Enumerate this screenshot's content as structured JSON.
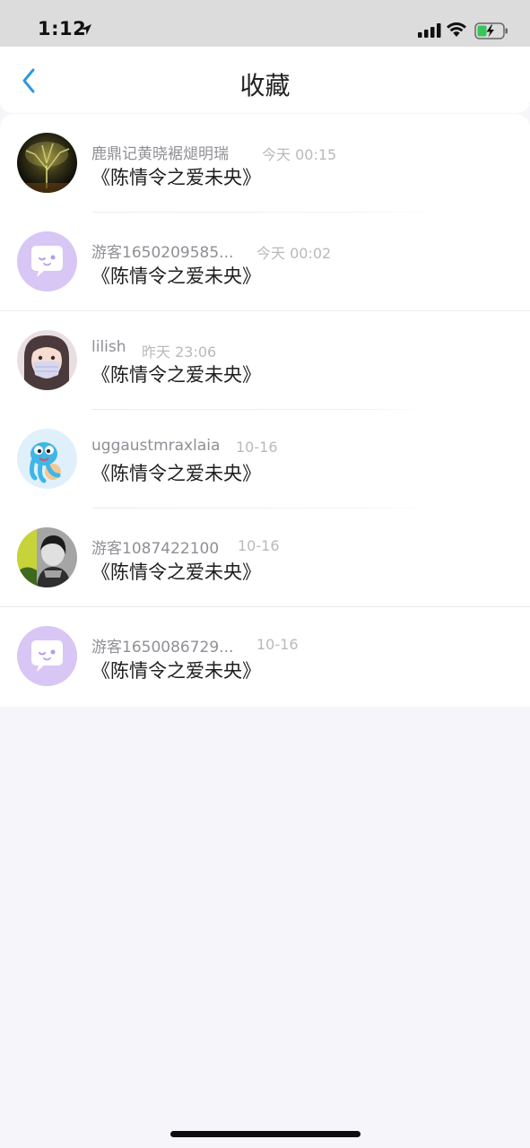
{
  "status_bar": {
    "time": "1:12",
    "icons": [
      "location-arrow-icon",
      "cellular-signal-icon",
      "wifi-icon",
      "battery-charging-icon"
    ],
    "battery_color": "#35c759"
  },
  "nav": {
    "title": "收藏",
    "back_icon": "chevron-left-icon",
    "accent_color": "#2d9cdb"
  },
  "favorites": [
    {
      "user": "鹿鼎记黄晓裾煺明瑞",
      "time": "今天 00:15",
      "title": "《陈情令之爱未央》",
      "avatar": "tree-photo"
    },
    {
      "user": "游客1650209585...",
      "time": "今天 00:02",
      "title": "《陈情令之爱未央》",
      "avatar": "default-chat-avatar"
    },
    {
      "user": "lilish",
      "time": "昨天 23:06",
      "title": "《陈情令之爱未央》",
      "avatar": "masked-girl-illustration"
    },
    {
      "user": "uggaustmraxlaia",
      "time": "10-16",
      "title": "《陈情令之爱未央》",
      "avatar": "cartoon-octopus"
    },
    {
      "user": "游客1087422100",
      "time": "10-16",
      "title": "《陈情令之爱未央》",
      "avatar": "bw-portrait-photo"
    },
    {
      "user": "游客1650086729...",
      "time": "10-16",
      "title": "《陈情令之爱未央》",
      "avatar": "default-chat-avatar"
    }
  ]
}
